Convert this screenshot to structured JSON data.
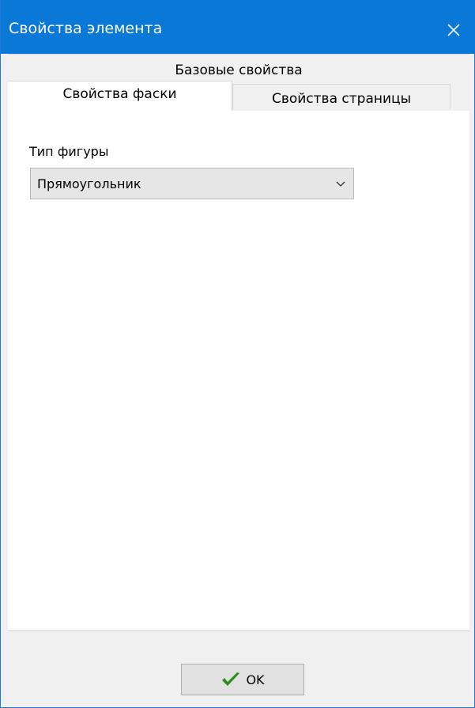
{
  "window": {
    "title": "Свойства элемента",
    "close_icon": "close-icon"
  },
  "tabs": {
    "back_row": "Базовые свойства",
    "active": "Свойства фаски",
    "inactive": "Свойства страницы"
  },
  "form": {
    "shape_type_label": "Тип фигуры",
    "shape_type_value": "Прямоугольник"
  },
  "footer": {
    "ok_label": "OK",
    "ok_icon": "checkmark-icon"
  },
  "colors": {
    "titlebar": "#0a78d7",
    "checkmark": "#2e8b1e"
  }
}
